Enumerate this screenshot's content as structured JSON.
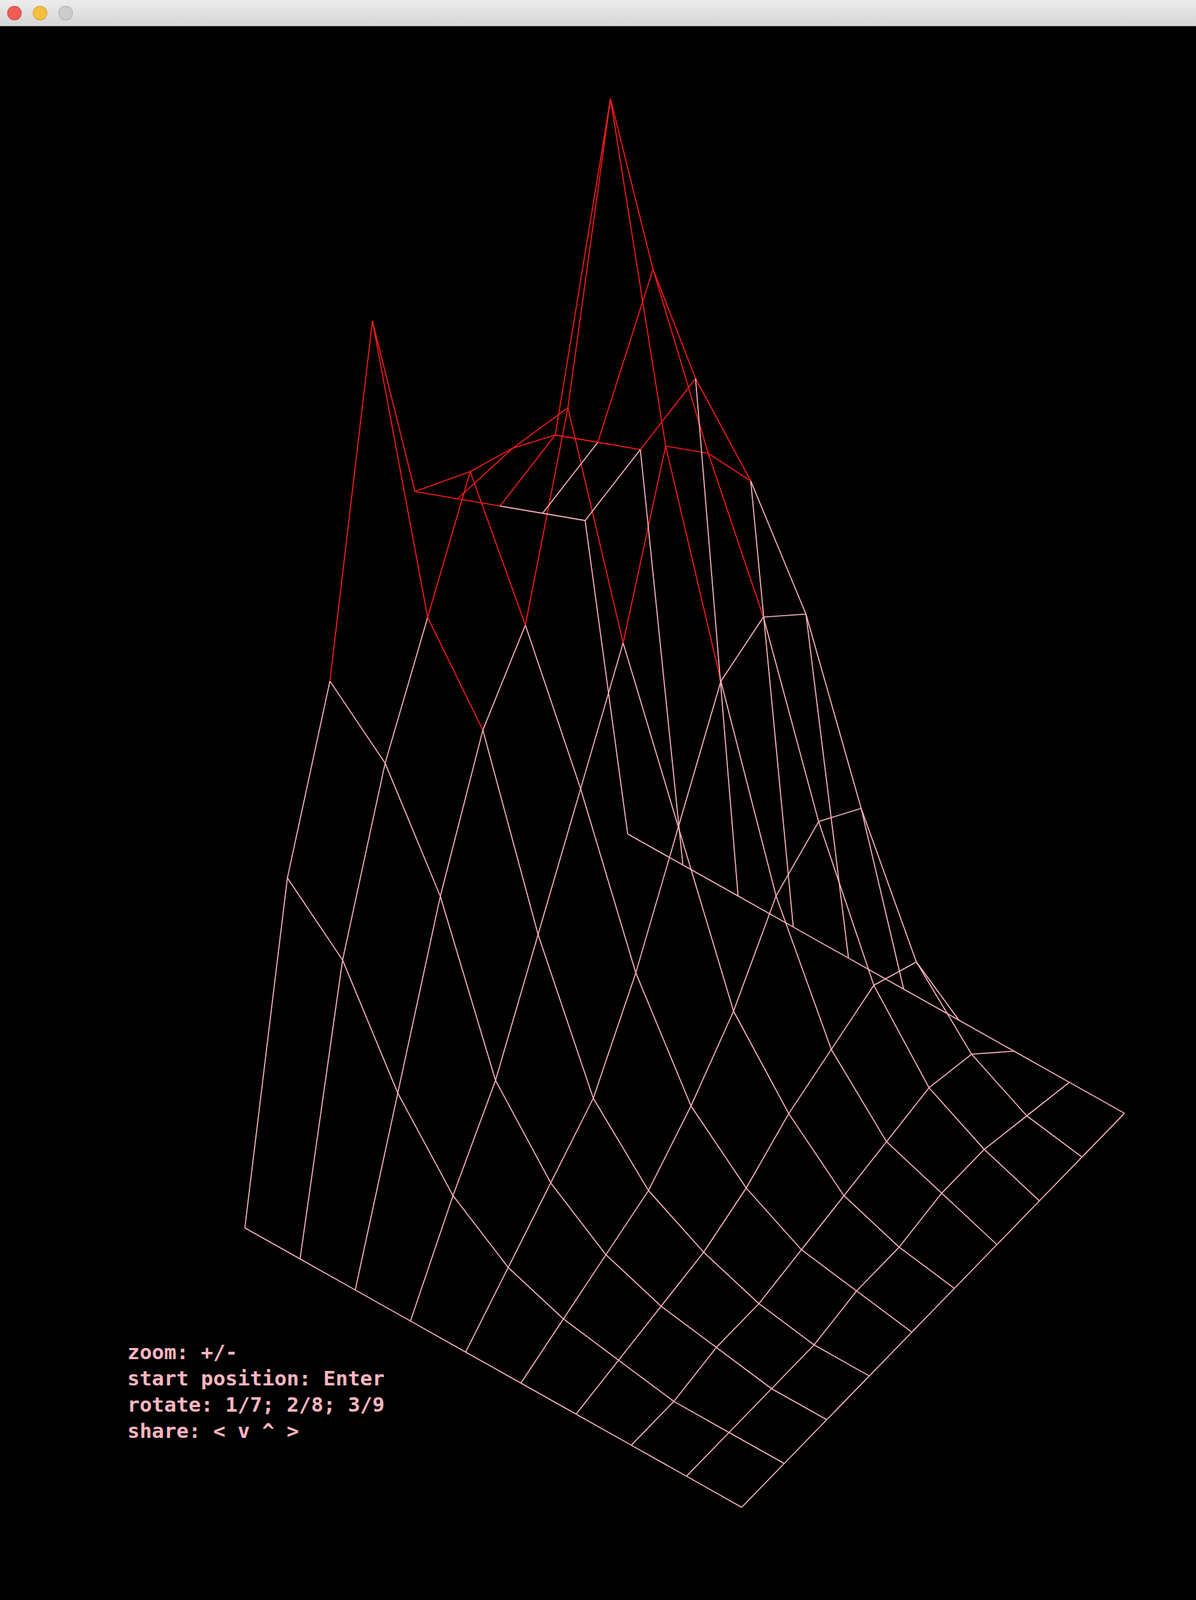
{
  "window": {
    "controls": [
      {
        "name": "close",
        "color": "#ee5c55",
        "disabled": false
      },
      {
        "name": "minimize",
        "color": "#f5be3f",
        "disabled": false
      },
      {
        "name": "zoom",
        "color": "#cdcdcd",
        "disabled": true
      }
    ]
  },
  "surface": {
    "heights": [
      [
        0,
        0,
        0,
        0,
        0,
        0,
        0,
        0,
        0,
        0
      ],
      [
        30,
        25,
        15,
        8,
        4,
        2,
        1,
        0,
        0,
        0
      ],
      [
        45,
        40,
        30,
        15,
        8,
        4,
        2,
        1,
        0,
        0
      ],
      [
        76,
        50,
        42,
        25,
        12,
        6,
        3,
        1,
        0,
        0
      ],
      [
        55,
        60,
        48,
        35,
        20,
        10,
        5,
        2,
        1,
        0
      ],
      [
        50,
        58,
        65,
        45,
        30,
        15,
        8,
        3,
        1,
        0
      ],
      [
        45,
        55,
        91,
        60,
        40,
        22,
        10,
        4,
        2,
        0
      ],
      [
        40,
        50,
        70,
        55,
        42,
        25,
        12,
        5,
        2,
        0
      ],
      [
        35,
        45,
        55,
        48,
        38,
        22,
        10,
        4,
        1,
        0
      ],
      [
        0,
        0,
        0,
        0,
        0,
        0,
        0,
        0,
        0,
        0
      ]
    ]
  },
  "help": [
    "zoom: +/-",
    "start position: Enter",
    "rotate: 1/7; 2/8; 3/9",
    "share: < v ^ >"
  ]
}
